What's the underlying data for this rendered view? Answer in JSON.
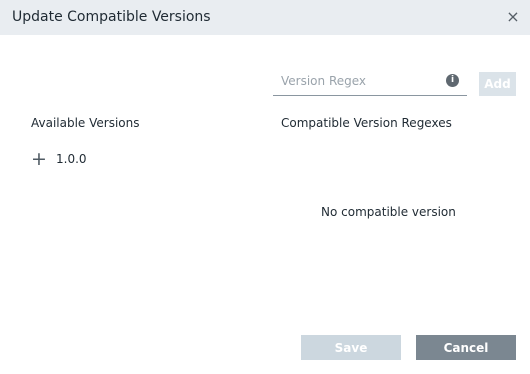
{
  "dialog": {
    "title": "Update Compatible Versions",
    "close_glyph": "×"
  },
  "regex": {
    "placeholder": "Version Regex",
    "value": "",
    "info_glyph": "i",
    "add_label": "Add"
  },
  "available": {
    "heading": "Available Versions",
    "items": [
      {
        "icon": "plus-icon",
        "label": "1.0.0"
      }
    ]
  },
  "compatible": {
    "heading": "Compatible Version Regexes",
    "empty_message": "No compatible version"
  },
  "footer": {
    "save_label": "Save",
    "cancel_label": "Cancel"
  },
  "colors": {
    "titlebar_bg": "#e9edf1",
    "add_button_disabled": "#dbe3e9",
    "save_button_disabled": "#ccd7df",
    "cancel_button": "#7b8791"
  }
}
